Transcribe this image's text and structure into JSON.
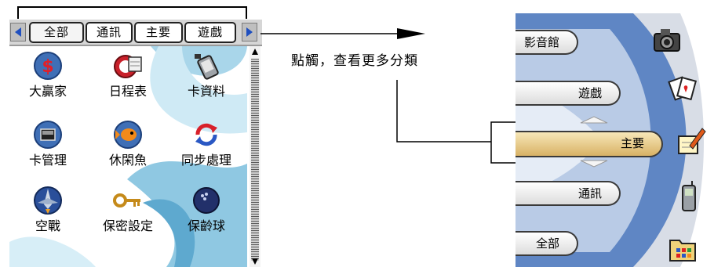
{
  "left_screen": {
    "tabs": [
      "全部",
      "通訊",
      "主要",
      "遊戲"
    ],
    "active_tab": "全部",
    "apps": [
      {
        "label": "大贏家",
        "icon": "dollar-coin-icon"
      },
      {
        "label": "日程表",
        "icon": "alarm-calendar-icon"
      },
      {
        "label": "卡資料",
        "icon": "card-data-icon"
      },
      {
        "label": "卡管理",
        "icon": "card-manager-icon"
      },
      {
        "label": "休閑魚",
        "icon": "fish-icon"
      },
      {
        "label": "同步處理",
        "icon": "sync-icon"
      },
      {
        "label": "空戰",
        "icon": "fighter-jet-icon"
      },
      {
        "label": "保密設定",
        "icon": "key-icon"
      },
      {
        "label": "保齡球",
        "icon": "bowling-ball-icon"
      }
    ]
  },
  "annotation": {
    "text": "點觸，查看更多分類"
  },
  "right_screen": {
    "menu": [
      "影音館",
      "遊戲",
      "主要",
      "通訊",
      "全部"
    ],
    "selected": "主要",
    "icons": [
      "camera-icon",
      "playing-cards-icon",
      "notepad-pencil-icon",
      "mobile-phone-icon",
      "folder-apps-icon"
    ]
  },
  "colors": {
    "tab_bar": "#d6d6d6",
    "selected_pill": "#e3c27a",
    "right_background": "#d8dde6",
    "dial_blue": "#5f86c4"
  }
}
